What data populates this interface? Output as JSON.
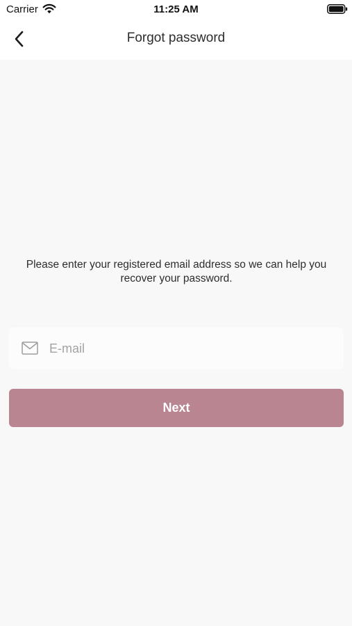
{
  "status_bar": {
    "carrier": "Carrier",
    "time": "11:25 AM",
    "wifi_icon": "wifi-icon",
    "battery_icon": "battery-icon"
  },
  "nav": {
    "title": "Forgot password",
    "back_icon": "chevron-left-icon"
  },
  "form": {
    "instruction": "Please enter your registered email address so we can help you recover your password.",
    "email_placeholder": "E-mail",
    "email_value": "",
    "email_icon": "mail-icon",
    "next_label": "Next"
  },
  "colors": {
    "background": "#f8f8f8",
    "header": "#ffffff",
    "button": "#b98591",
    "button_text": "#ffffff",
    "placeholder": "#a3a3a3"
  }
}
